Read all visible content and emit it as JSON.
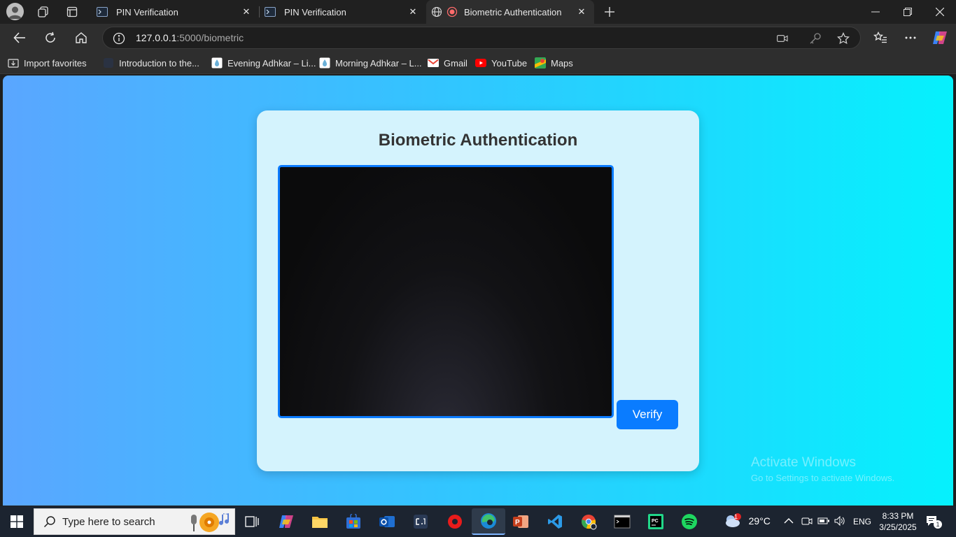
{
  "browser": {
    "tabs": [
      {
        "title": "PIN Verification",
        "close": "✕"
      },
      {
        "title": "PIN Verification",
        "close": "✕"
      },
      {
        "title": "Biometric Authentication",
        "close": "✕"
      }
    ],
    "address": {
      "host": "127.0.0.1",
      "rest": ":5000/biometric"
    },
    "bookmarks": [
      "Import favorites",
      "Introduction to the...",
      "Evening Adhkar – Li...",
      "Morning Adhkar – L...",
      "Gmail",
      "YouTube",
      "Maps"
    ]
  },
  "page": {
    "heading": "Biometric Authentication",
    "verify_label": "Verify"
  },
  "watermark": {
    "line1": "Activate Windows",
    "line2": "Go to Settings to activate Windows."
  },
  "taskbar": {
    "search_placeholder": "Type here to search",
    "weather": "29°C",
    "language": "ENG",
    "time": "8:33 PM",
    "date": "3/25/2025",
    "notification_count": "1",
    "weather_badge": "1"
  },
  "colors": {
    "accent": "#0a7cff",
    "card_bg": "#d4f3fd",
    "gradient_start": "#5aa6ff",
    "gradient_end": "#05f1fd"
  }
}
